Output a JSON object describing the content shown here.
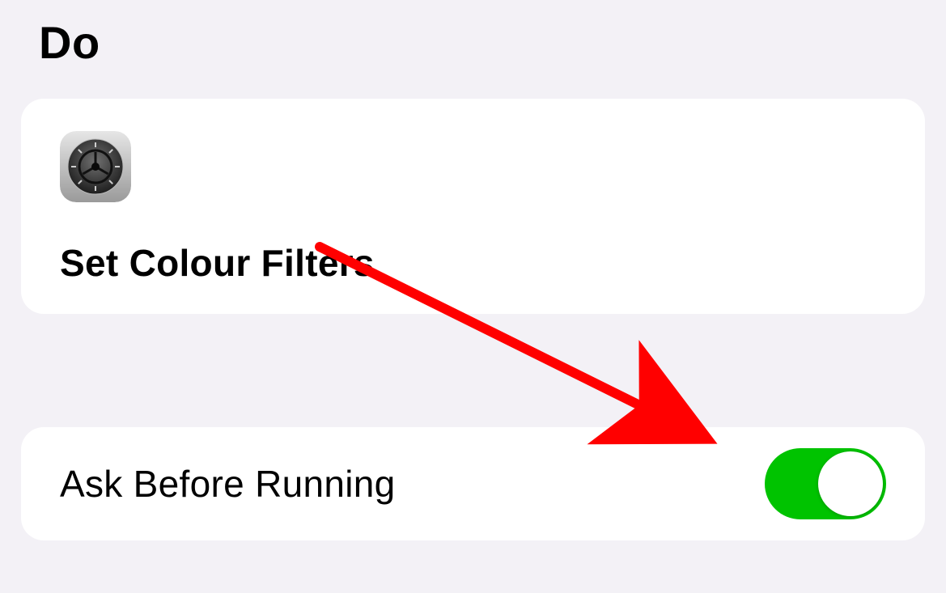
{
  "header": {
    "title": "Do"
  },
  "action": {
    "icon_name": "settings-app-icon",
    "title": "Set Colour Filters"
  },
  "toggle": {
    "label": "Ask Before Running",
    "state": "on",
    "color_on": "#00c300"
  },
  "annotation": {
    "type": "arrow",
    "color": "#ff0000"
  }
}
